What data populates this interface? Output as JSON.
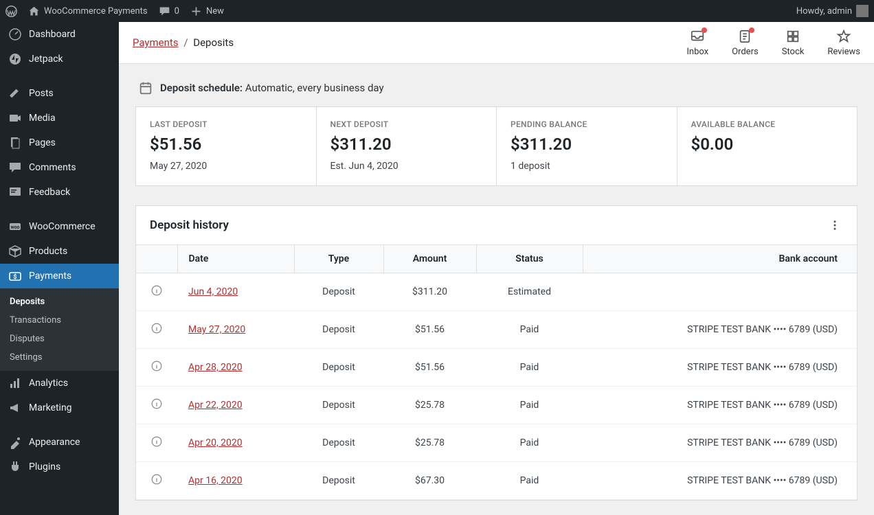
{
  "adminbar": {
    "site_name": "WooCommerce Payments",
    "comments": "0",
    "new_label": "New",
    "howdy": "Howdy, admin"
  },
  "sidebar": {
    "dashboard": "Dashboard",
    "jetpack": "Jetpack",
    "posts": "Posts",
    "media": "Media",
    "pages": "Pages",
    "comments": "Comments",
    "feedback": "Feedback",
    "woocommerce": "WooCommerce",
    "products": "Products",
    "payments": "Payments",
    "analytics": "Analytics",
    "marketing": "Marketing",
    "appearance": "Appearance",
    "plugins": "Plugins",
    "submenu": {
      "deposits": "Deposits",
      "transactions": "Transactions",
      "disputes": "Disputes",
      "settings": "Settings"
    }
  },
  "breadcrumb": {
    "parent": "Payments",
    "current": "Deposits"
  },
  "activity": {
    "inbox": "Inbox",
    "orders": "Orders",
    "stock": "Stock",
    "reviews": "Reviews"
  },
  "schedule": {
    "label": "Deposit schedule:",
    "value": "Automatic, every business day"
  },
  "cards": {
    "last": {
      "label": "LAST DEPOSIT",
      "value": "$51.56",
      "sub": "May 27, 2020"
    },
    "next": {
      "label": "NEXT DEPOSIT",
      "value": "$311.20",
      "sub": "Est. Jun 4, 2020"
    },
    "pending": {
      "label": "PENDING BALANCE",
      "value": "$311.20",
      "sub": "1 deposit"
    },
    "available": {
      "label": "AVAILABLE BALANCE",
      "value": "$0.00",
      "sub": ""
    }
  },
  "table": {
    "title": "Deposit history",
    "cols": {
      "date": "Date",
      "type": "Type",
      "amount": "Amount",
      "status": "Status",
      "bank": "Bank account"
    },
    "rows": [
      {
        "date": "Jun 4, 2020",
        "type": "Deposit",
        "amount": "$311.20",
        "status": "Estimated",
        "bank": ""
      },
      {
        "date": "May 27, 2020",
        "type": "Deposit",
        "amount": "$51.56",
        "status": "Paid",
        "bank": "STRIPE TEST BANK •••• 6789 (USD)"
      },
      {
        "date": "Apr 28, 2020",
        "type": "Deposit",
        "amount": "$51.56",
        "status": "Paid",
        "bank": "STRIPE TEST BANK •••• 6789 (USD)"
      },
      {
        "date": "Apr 22, 2020",
        "type": "Deposit",
        "amount": "$25.78",
        "status": "Paid",
        "bank": "STRIPE TEST BANK •••• 6789 (USD)"
      },
      {
        "date": "Apr 20, 2020",
        "type": "Deposit",
        "amount": "$25.78",
        "status": "Paid",
        "bank": "STRIPE TEST BANK •••• 6789 (USD)"
      },
      {
        "date": "Apr 16, 2020",
        "type": "Deposit",
        "amount": "$67.30",
        "status": "Paid",
        "bank": "STRIPE TEST BANK •••• 6789 (USD)"
      }
    ]
  }
}
